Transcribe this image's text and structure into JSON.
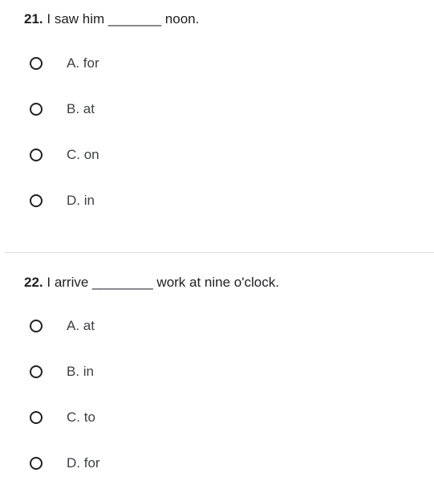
{
  "questions": [
    {
      "number": "21.",
      "text": "I saw him _______ noon.",
      "options": [
        "A. for",
        "B. at",
        "C. on",
        "D. in"
      ]
    },
    {
      "number": "22.",
      "text": "I arrive ________ work at nine o'clock.",
      "options": [
        "A. at",
        "B. in",
        "C. to",
        "D. for"
      ]
    }
  ]
}
